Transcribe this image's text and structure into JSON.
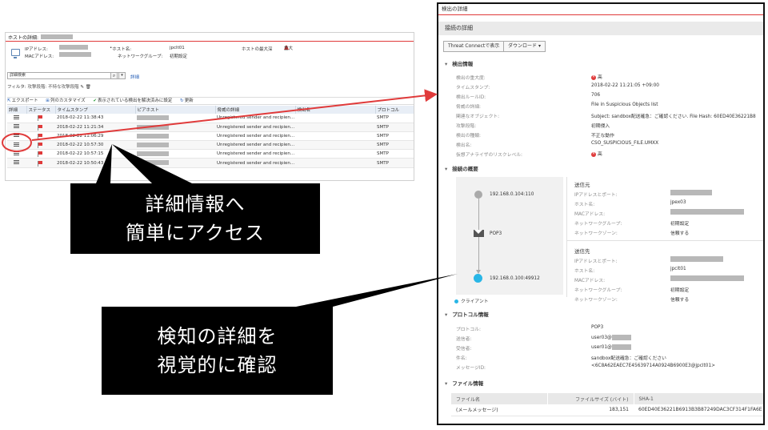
{
  "host_window": {
    "title": "ホストの詳細:",
    "info": {
      "ip_label": "IPアドレス:",
      "mac_label": "MACアドレス:",
      "hostname_label": "ホスト名:",
      "hostname_value": "jpclt01",
      "network_group_label": "ネットワークグループ:",
      "network_group_value": "初期設定",
      "max_severity_label": "ホストの最大深",
      "max_severity_value": "重大"
    },
    "search": {
      "value": "詳細検索",
      "button_icon": "search-icon",
      "link": "詳細"
    },
    "filter": {
      "label": "フィルタ:",
      "condition": "攻撃段階: 不特な攻撃段階"
    },
    "toolbar": {
      "export": "エクスポート",
      "customize_columns": "列のカスタマイズ",
      "mark_resolved": "表示されている検出を解決済みに設定",
      "update": "更新"
    },
    "columns": [
      "詳細",
      "ステータス",
      "タイムスタンプ",
      "ピアホスト",
      "脅威の詳細",
      "検出名",
      "プロトコル"
    ],
    "rows": [
      {
        "timestamp": "2018-02-22 11:38:43",
        "threat": "Unregistered sender and recipient d...",
        "protocol": "SMTP"
      },
      {
        "timestamp": "2018-02-22 11:21:34",
        "threat": "Unregistered sender and recipient d...",
        "protocol": "SMTP"
      },
      {
        "timestamp": "2018-02-22 11:06:29",
        "threat": "Unregistered sender and recipient d...",
        "protocol": "SMTP"
      },
      {
        "timestamp": "2018-02-22 10:57:30",
        "threat": "Unregistered sender and recipient d...",
        "protocol": "SMTP"
      },
      {
        "timestamp": "2018-02-22 10:57:15",
        "threat": "Unregistered sender and recipient d...",
        "protocol": "SMTP"
      },
      {
        "timestamp": "2018-02-22 10:50:43",
        "threat": "Unregistered sender and recipient d...",
        "protocol": "SMTP"
      }
    ]
  },
  "detection_window": {
    "title": "検出の詳細",
    "subtitle": "接続の詳細",
    "buttons": {
      "threat_connect": "Threat Connectで表示",
      "download": "ダウンロード"
    },
    "sections": {
      "detection_info": "検出情報",
      "connection_summary": "接続の概要",
      "protocol_info": "プロトコル情報",
      "file_info": "ファイル情報"
    },
    "detection_info": [
      {
        "key": "検出の重大度:",
        "value": "高"
      },
      {
        "key": "タイムスタンプ:",
        "value": "2018-02-22 11:21:05 +09:00"
      },
      {
        "key": "検出ルールID:",
        "value": "706"
      },
      {
        "key": "脅威の詳細:",
        "value": "File in Suspicious Objects list"
      },
      {
        "key": "関連なオブジェクト:",
        "value": "Subject: sandbox配送確急：ご確認ください. File Hash: 60ED40E36221B8"
      },
      {
        "key": "攻撃段階:",
        "value": "初期侵入"
      },
      {
        "key": "検出の種類:",
        "value": "不正な動作"
      },
      {
        "key": "検出名:",
        "value": "CSO_SUSPICIOUS_FILE.UMXX"
      },
      {
        "key": "仮想アナライザのリスクレベル:",
        "value": "高"
      }
    ],
    "severity_icon": "severity-x-icon",
    "diagram": {
      "host_ip": "192.168.0.104:110",
      "protocol": "POP3",
      "client_ip": "192.168.0.100:49912",
      "client_legend": "クライアント"
    },
    "sender": {
      "heading": "送信元",
      "ip_label": "IPアドレスとポート:",
      "hostname_label": "ホスト名:",
      "hostname_value": "jpex03",
      "mac_label": "MACアドレス:",
      "group_label": "ネットワークグループ:",
      "group_value": "初期設定",
      "zone_label": "ネットワークゾーン:",
      "zone_value": "信頼する"
    },
    "receiver": {
      "heading": "送信先",
      "ip_label": "IPアドレスとポート:",
      "hostname_label": "ホスト名:",
      "hostname_value": "jpclt01",
      "mac_label": "MACアドレス:",
      "group_label": "ネットワークグループ:",
      "group_value": "初期設定",
      "zone_label": "ネットワークゾーン:",
      "zone_value": "信頼する"
    },
    "protocol_info": [
      {
        "key": "プロトコル:",
        "value": "POP3"
      },
      {
        "key": "送信者:",
        "value": "user03@"
      },
      {
        "key": "受信者:",
        "value": "user01@"
      },
      {
        "key": "件名:",
        "value": "sandbox配送確急：ご確認ください"
      },
      {
        "key": "メッセージID:",
        "value": "<6C8A62EAEC7E45639714A0924B6900E3@jpclt01>"
      }
    ],
    "file_table": {
      "columns": [
        "ファイル名",
        "ファイルサイズ (バイト)",
        "SHA-1"
      ],
      "rows": [
        {
          "name": "(メールメッセージ)",
          "size": "183,151",
          "sha1": "60ED40E36221B6913B3B87249DAC3CF314F1FA6E"
        }
      ]
    }
  },
  "callouts": {
    "access": [
      "詳細情報へ",
      "簡単にアクセス"
    ],
    "visual": [
      "検知の詳細を",
      "視覚的に確認"
    ]
  },
  "colors": {
    "accent_red": "#e03a3a",
    "link_blue": "#2a62b8",
    "client_cyan": "#29b6e6",
    "callout_bg": "#000000"
  }
}
